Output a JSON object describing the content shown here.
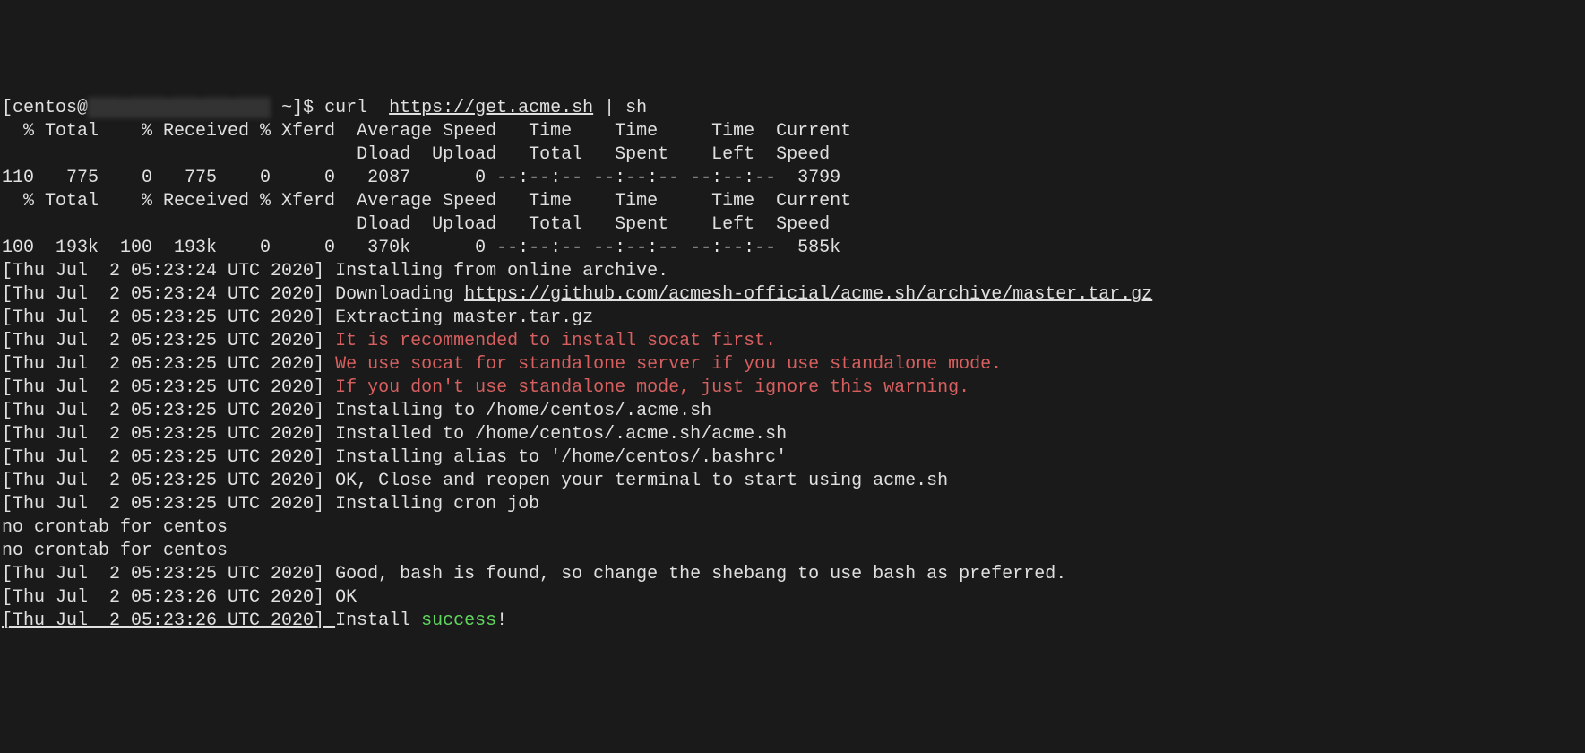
{
  "prompt": {
    "user_host_prefix": "[centos@",
    "redacted_host": "███ ███ ██ ██ ███",
    "path_suffix": " ~]$ ",
    "command_prefix": "curl  ",
    "command_url": "https://get.acme.sh",
    "command_suffix": " | sh"
  },
  "curl_header1": "  % Total    % Received % Xferd  Average Speed   Time    Time     Time  Current",
  "curl_header2": "                                 Dload  Upload   Total   Spent    Left  Speed",
  "curl_line1": "110   775    0   775    0     0   2087      0 --:--:-- --:--:-- --:--:--  3799",
  "curl_header3": "  % Total    % Received % Xferd  Average Speed   Time    Time     Time  Current",
  "curl_header4": "                                 Dload  Upload   Total   Spent    Left  Speed",
  "curl_line2": "100  193k  100  193k    0     0   370k      0 --:--:-- --:--:-- --:--:--  585k",
  "log": {
    "ts1": "[Thu Jul  2 05:23:24 UTC 2020] ",
    "msg1": "Installing from online archive.",
    "ts2": "[Thu Jul  2 05:23:24 UTC 2020] ",
    "msg2a": "Downloading ",
    "msg2_url": "https://github.com/acmesh-official/acme.sh/archive/master.tar.gz",
    "ts3": "[Thu Jul  2 05:23:25 UTC 2020] ",
    "msg3": "Extracting master.tar.gz",
    "ts4": "[Thu Jul  2 05:23:25 UTC 2020] ",
    "msg4": "It is recommended to install socat first.",
    "ts5": "[Thu Jul  2 05:23:25 UTC 2020] ",
    "msg5": "We use socat for standalone server if you use standalone mode.",
    "ts6": "[Thu Jul  2 05:23:25 UTC 2020] ",
    "msg6": "If you don't use standalone mode, just ignore this warning.",
    "ts7": "[Thu Jul  2 05:23:25 UTC 2020] ",
    "msg7": "Installing to /home/centos/.acme.sh",
    "ts8": "[Thu Jul  2 05:23:25 UTC 2020] ",
    "msg8": "Installed to /home/centos/.acme.sh/acme.sh",
    "ts9": "[Thu Jul  2 05:23:25 UTC 2020] ",
    "msg9": "Installing alias to '/home/centos/.bashrc'",
    "ts10": "[Thu Jul  2 05:23:25 UTC 2020] ",
    "msg10": "OK, Close and reopen your terminal to start using acme.sh",
    "ts11": "[Thu Jul  2 05:23:25 UTC 2020] ",
    "msg11": "Installing cron job",
    "cron1": "no crontab for centos",
    "cron2": "no crontab for centos",
    "ts12": "[Thu Jul  2 05:23:25 UTC 2020] ",
    "msg12": "Good, bash is found, so change the shebang to use bash as preferred.",
    "ts13": "[Thu Jul  2 05:23:26 UTC 2020] ",
    "msg13": "OK",
    "ts14": "[Thu Jul  2 05:23:26 UTC 2020] ",
    "msg14a": "Install ",
    "msg14b": "success",
    "msg14c": "!"
  }
}
